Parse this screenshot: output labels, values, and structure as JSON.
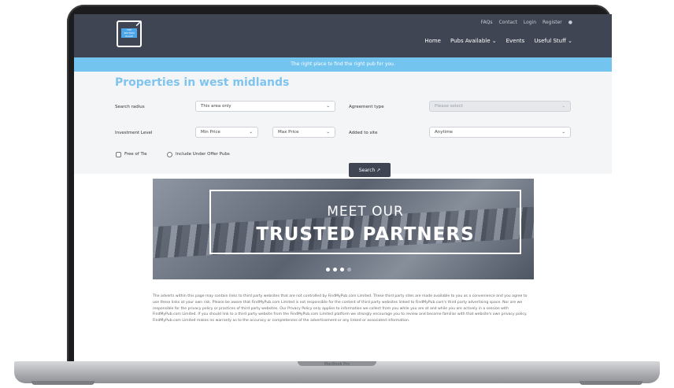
{
  "device": {
    "brand": "MacBook Pro"
  },
  "nav": {
    "logo_text": "THE SECTION PLACE",
    "top_links": [
      "FAQs",
      "Contact",
      "Login",
      "Register"
    ],
    "main_links": [
      "Home",
      "Pubs Available ⌄",
      "Events",
      "Useful Stuff ⌄"
    ]
  },
  "strip": {
    "text": "The right place to find the right pub for you."
  },
  "search": {
    "title": "Properties in west midlands",
    "radius_label": "Search radius",
    "radius_value": "This area only",
    "agreement_label": "Agreement type",
    "agreement_placeholder": "Please select",
    "investment_label": "Investment Level",
    "min_price": "Min Price",
    "max_price": "Max Price",
    "added_label": "Added to site",
    "added_value": "Anytime",
    "free_of_tie": "Free of Tie",
    "under_offer": "Include Under Offer Pubs",
    "button": "Search ↗"
  },
  "banner": {
    "line1": "MEET OUR",
    "line2": "TRUSTED PARTNERS"
  },
  "paragraph": "The adverts within this page may contain links to third party websites that are not controlled by FindMyPub.com Limited. These third party sites are made available to you as a convenience and you agree to use these links at your own risk. Please be aware that FindMyPub.com Limited is not responsible for the content of third party websites linked to FindMyPub.com's third party advertising space. Nor are we responsible for the privacy policy or practices of third party websites. Our Privacy Policy only applies to information we collect from you while you are at and while you are actively in a session with FindMyPub.com Limited. If you should link to a third party website from the FindMyPub.com Limited platform we strongly encourage you to review and become familiar with that website's own privacy policy. FindMyPub.com Limited makes no warranty as to the accuracy or completeness of the advertisement or any linked or associated information."
}
